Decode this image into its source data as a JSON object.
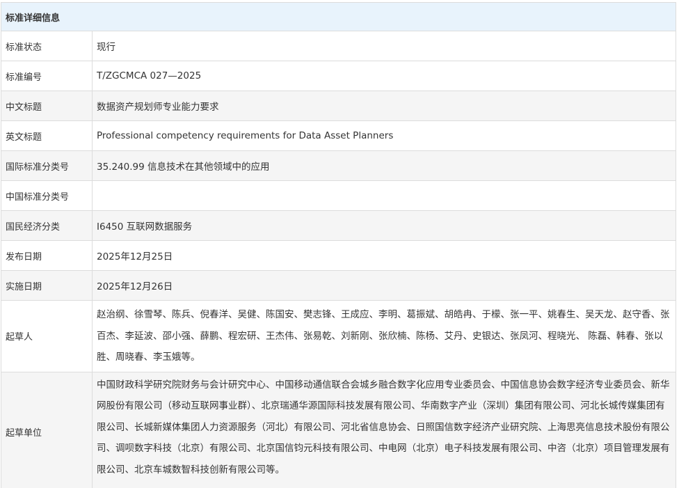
{
  "header": {
    "title": "标准详细信息"
  },
  "rows": [
    {
      "label": "标准状态",
      "value": "现行"
    },
    {
      "label": "标准编号",
      "value": "T/ZGCMCA 027—2025"
    },
    {
      "label": "中文标题",
      "value": "数据资产规划师专业能力要求"
    },
    {
      "label": "英文标题",
      "value": "Professional competency requirements for Data Asset Planners"
    },
    {
      "label": "国际标准分类号",
      "value": "35.240.99 信息技术在其他领域中的应用"
    },
    {
      "label": "中国标准分类号",
      "value": ""
    },
    {
      "label": "国民经济分类",
      "value": "I6450 互联网数据服务"
    },
    {
      "label": "发布日期",
      "value": "2025年12月25日"
    },
    {
      "label": "实施日期",
      "value": "2025年12月26日"
    },
    {
      "label": "起草人",
      "value": "赵治纲、徐雪琴、陈兵、倪春洋、吴健、陈国安、樊志锋、王成应、李明、葛振斌、胡皓冉、于檬、张一平、姚春生、吴天龙、赵守香、张百杰、李延波、邵小强、薛鹏、程宏研、王杰伟、张易乾、刘新刚、张欣楠、陈杨、艾丹、史银达、张凤河、程晓光、 陈磊、韩春、张以胜、周晓春、李玉娥等。"
    },
    {
      "label": "起草单位",
      "value": "中国财政科学研究院财务与会计研究中心、中国移动通信联合会城乡融合数字化应用专业委员会、中国信息协会数字经济专业委员会、新华网股份有限公司（移动互联网事业群）、北京瑞通华源国际科技发展有限公司、华南数字产业（深圳）集团有限公司、河北长城传媒集团有限公司、长城新媒体集团人力资源服务（河北）有限公司、河北省信息协会、日照国信数字经济产业研究院、上海思亮信息技术股份有限公司、调呗数字科技（北京）有限公司、北京国信钧元科技有限公司、中电网（北京）电子科技发展有限公司、中咨（北京）项目管理发展有限公司、北京车城数智科技创新有限公司等。"
    }
  ]
}
